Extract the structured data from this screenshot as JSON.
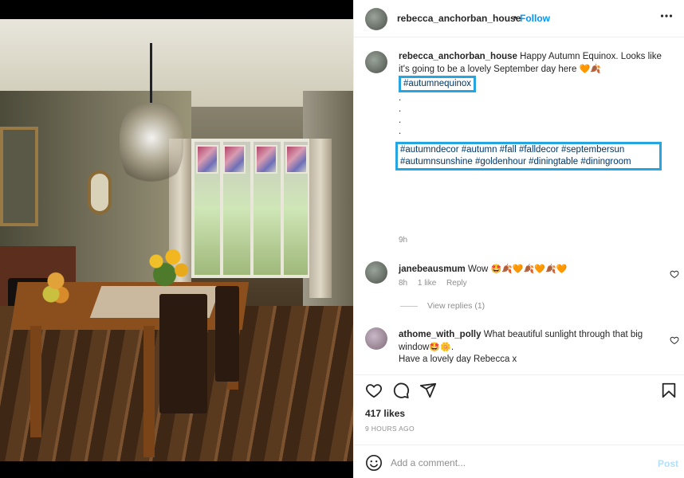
{
  "post": {
    "username": "rebecca_anchorban_house",
    "follow_label": "Follow",
    "more_label": "•••",
    "separator": "•"
  },
  "caption": {
    "username": "rebecca_anchorban_house",
    "text": "Happy Autumn Equinox. Looks like it's going to be a lovely September day here",
    "emojis": "🧡🍂",
    "highlight_tag": "#autumnequinox",
    "dots": [
      ".",
      ".",
      ".",
      "."
    ],
    "tags": "#autumndecor #autumn #fall #falldecor #septembersun #autumnsunshine #goldenhour #diningtable #diningroom",
    "time": "9h"
  },
  "comments": [
    {
      "username": "janebeausmum",
      "text": "Wow",
      "emojis": "🤩🍂🧡🍂🧡🍂🧡",
      "time": "8h",
      "likes": "1 like",
      "reply_label": "Reply"
    },
    {
      "username": "athome_with_polly",
      "text": "What beautiful sunlight through that big window",
      "emojis": "🤩🌼.",
      "text2": "Have a lovely day Rebecca x"
    }
  ],
  "view_replies_label": "View replies (1)",
  "likes_label": "417 likes",
  "posted_ago": "9 HOURS AGO",
  "add_comment": {
    "placeholder": "Add a comment...",
    "post_label": "Post"
  },
  "icons": [
    "heart-icon",
    "comment-icon",
    "share-icon",
    "bookmark-icon",
    "emoji-icon",
    "small-heart-icon"
  ],
  "colors": {
    "link": "#0095f6",
    "highlight_box": "#27a5e0",
    "hashtag": "#00376b",
    "muted": "#8e8e8e",
    "post_disabled": "#b2dffc"
  }
}
